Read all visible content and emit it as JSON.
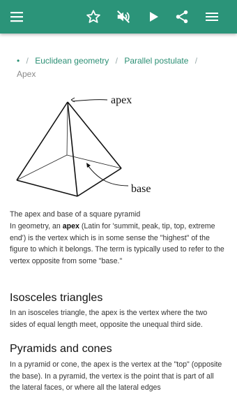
{
  "toolbar": {
    "icons": [
      "menu-icon",
      "star-icon",
      "mute-icon",
      "play-icon",
      "share-icon",
      "list-icon"
    ],
    "color": "#2b9479"
  },
  "breadcrumb": {
    "home": "•",
    "items": [
      "Euclidean geometry",
      "Parallel postulate"
    ],
    "current": "Apex"
  },
  "figure": {
    "apex_label": "apex",
    "base_label": "base"
  },
  "article": {
    "caption": "The apex and base of a square pyramid",
    "intro_before": "In geometry, an ",
    "intro_bold": "apex",
    "intro_after": " (Latin for 'summit, peak, tip, top, extreme end') is the vertex which is in some sense the \"highest\" of the figure to which it belongs. The term is typically used to refer to the vertex opposite from some \"base.\"",
    "section1_title": "Isosceles triangles",
    "section1_text": "In an isosceles triangle, the apex is the vertex where the two sides of equal length meet, opposite the unequal third side.",
    "section2_title": "Pyramids and cones",
    "section2_text": "In a pyramid or cone, the apex is the vertex at the \"top\" (opposite the base). In a pyramid, the vertex is the point that is part of all the lateral faces, or where all the lateral edges"
  }
}
